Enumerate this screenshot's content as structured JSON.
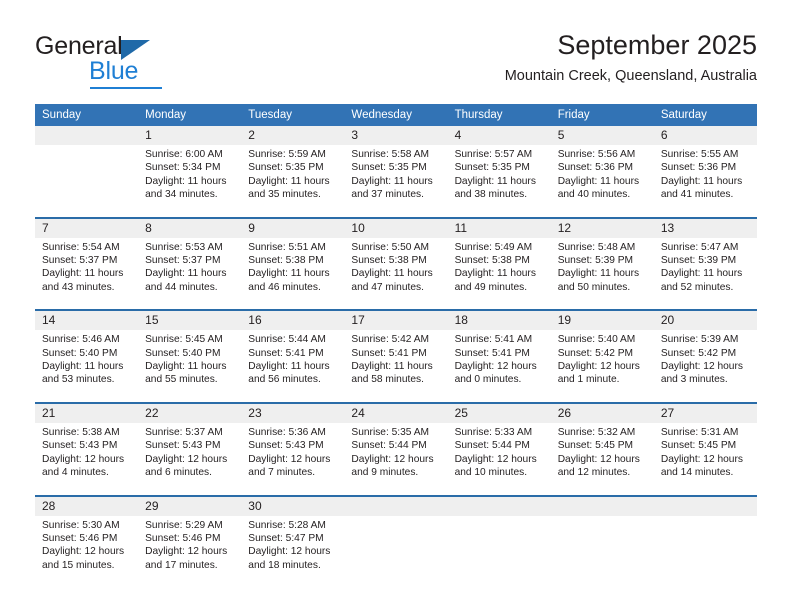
{
  "brand": {
    "name_top": "General",
    "name_bottom": "Blue"
  },
  "header": {
    "title": "September 2025",
    "subtitle": "Mountain Creek, Queensland, Australia"
  },
  "colors": {
    "header_blue": "#3273b5",
    "divider_blue": "#2a6ca8",
    "daynum_bg": "#efefef",
    "brand_blue": "#1f7fd4",
    "text": "#231f20"
  },
  "weekdays": [
    "Sunday",
    "Monday",
    "Tuesday",
    "Wednesday",
    "Thursday",
    "Friday",
    "Saturday"
  ],
  "weeks": [
    [
      {
        "day": "",
        "lines": []
      },
      {
        "day": "1",
        "lines": [
          "Sunrise: 6:00 AM",
          "Sunset: 5:34 PM",
          "Daylight: 11 hours",
          "and 34 minutes."
        ]
      },
      {
        "day": "2",
        "lines": [
          "Sunrise: 5:59 AM",
          "Sunset: 5:35 PM",
          "Daylight: 11 hours",
          "and 35 minutes."
        ]
      },
      {
        "day": "3",
        "lines": [
          "Sunrise: 5:58 AM",
          "Sunset: 5:35 PM",
          "Daylight: 11 hours",
          "and 37 minutes."
        ]
      },
      {
        "day": "4",
        "lines": [
          "Sunrise: 5:57 AM",
          "Sunset: 5:35 PM",
          "Daylight: 11 hours",
          "and 38 minutes."
        ]
      },
      {
        "day": "5",
        "lines": [
          "Sunrise: 5:56 AM",
          "Sunset: 5:36 PM",
          "Daylight: 11 hours",
          "and 40 minutes."
        ]
      },
      {
        "day": "6",
        "lines": [
          "Sunrise: 5:55 AM",
          "Sunset: 5:36 PM",
          "Daylight: 11 hours",
          "and 41 minutes."
        ]
      }
    ],
    [
      {
        "day": "7",
        "lines": [
          "Sunrise: 5:54 AM",
          "Sunset: 5:37 PM",
          "Daylight: 11 hours",
          "and 43 minutes."
        ]
      },
      {
        "day": "8",
        "lines": [
          "Sunrise: 5:53 AM",
          "Sunset: 5:37 PM",
          "Daylight: 11 hours",
          "and 44 minutes."
        ]
      },
      {
        "day": "9",
        "lines": [
          "Sunrise: 5:51 AM",
          "Sunset: 5:38 PM",
          "Daylight: 11 hours",
          "and 46 minutes."
        ]
      },
      {
        "day": "10",
        "lines": [
          "Sunrise: 5:50 AM",
          "Sunset: 5:38 PM",
          "Daylight: 11 hours",
          "and 47 minutes."
        ]
      },
      {
        "day": "11",
        "lines": [
          "Sunrise: 5:49 AM",
          "Sunset: 5:38 PM",
          "Daylight: 11 hours",
          "and 49 minutes."
        ]
      },
      {
        "day": "12",
        "lines": [
          "Sunrise: 5:48 AM",
          "Sunset: 5:39 PM",
          "Daylight: 11 hours",
          "and 50 minutes."
        ]
      },
      {
        "day": "13",
        "lines": [
          "Sunrise: 5:47 AM",
          "Sunset: 5:39 PM",
          "Daylight: 11 hours",
          "and 52 minutes."
        ]
      }
    ],
    [
      {
        "day": "14",
        "lines": [
          "Sunrise: 5:46 AM",
          "Sunset: 5:40 PM",
          "Daylight: 11 hours",
          "and 53 minutes."
        ]
      },
      {
        "day": "15",
        "lines": [
          "Sunrise: 5:45 AM",
          "Sunset: 5:40 PM",
          "Daylight: 11 hours",
          "and 55 minutes."
        ]
      },
      {
        "day": "16",
        "lines": [
          "Sunrise: 5:44 AM",
          "Sunset: 5:41 PM",
          "Daylight: 11 hours",
          "and 56 minutes."
        ]
      },
      {
        "day": "17",
        "lines": [
          "Sunrise: 5:42 AM",
          "Sunset: 5:41 PM",
          "Daylight: 11 hours",
          "and 58 minutes."
        ]
      },
      {
        "day": "18",
        "lines": [
          "Sunrise: 5:41 AM",
          "Sunset: 5:41 PM",
          "Daylight: 12 hours",
          "and 0 minutes."
        ]
      },
      {
        "day": "19",
        "lines": [
          "Sunrise: 5:40 AM",
          "Sunset: 5:42 PM",
          "Daylight: 12 hours",
          "and 1 minute."
        ]
      },
      {
        "day": "20",
        "lines": [
          "Sunrise: 5:39 AM",
          "Sunset: 5:42 PM",
          "Daylight: 12 hours",
          "and 3 minutes."
        ]
      }
    ],
    [
      {
        "day": "21",
        "lines": [
          "Sunrise: 5:38 AM",
          "Sunset: 5:43 PM",
          "Daylight: 12 hours",
          "and 4 minutes."
        ]
      },
      {
        "day": "22",
        "lines": [
          "Sunrise: 5:37 AM",
          "Sunset: 5:43 PM",
          "Daylight: 12 hours",
          "and 6 minutes."
        ]
      },
      {
        "day": "23",
        "lines": [
          "Sunrise: 5:36 AM",
          "Sunset: 5:43 PM",
          "Daylight: 12 hours",
          "and 7 minutes."
        ]
      },
      {
        "day": "24",
        "lines": [
          "Sunrise: 5:35 AM",
          "Sunset: 5:44 PM",
          "Daylight: 12 hours",
          "and 9 minutes."
        ]
      },
      {
        "day": "25",
        "lines": [
          "Sunrise: 5:33 AM",
          "Sunset: 5:44 PM",
          "Daylight: 12 hours",
          "and 10 minutes."
        ]
      },
      {
        "day": "26",
        "lines": [
          "Sunrise: 5:32 AM",
          "Sunset: 5:45 PM",
          "Daylight: 12 hours",
          "and 12 minutes."
        ]
      },
      {
        "day": "27",
        "lines": [
          "Sunrise: 5:31 AM",
          "Sunset: 5:45 PM",
          "Daylight: 12 hours",
          "and 14 minutes."
        ]
      }
    ],
    [
      {
        "day": "28",
        "lines": [
          "Sunrise: 5:30 AM",
          "Sunset: 5:46 PM",
          "Daylight: 12 hours",
          "and 15 minutes."
        ]
      },
      {
        "day": "29",
        "lines": [
          "Sunrise: 5:29 AM",
          "Sunset: 5:46 PM",
          "Daylight: 12 hours",
          "and 17 minutes."
        ]
      },
      {
        "day": "30",
        "lines": [
          "Sunrise: 5:28 AM",
          "Sunset: 5:47 PM",
          "Daylight: 12 hours",
          "and 18 minutes."
        ]
      },
      {
        "day": "",
        "lines": []
      },
      {
        "day": "",
        "lines": []
      },
      {
        "day": "",
        "lines": []
      },
      {
        "day": "",
        "lines": []
      }
    ]
  ]
}
